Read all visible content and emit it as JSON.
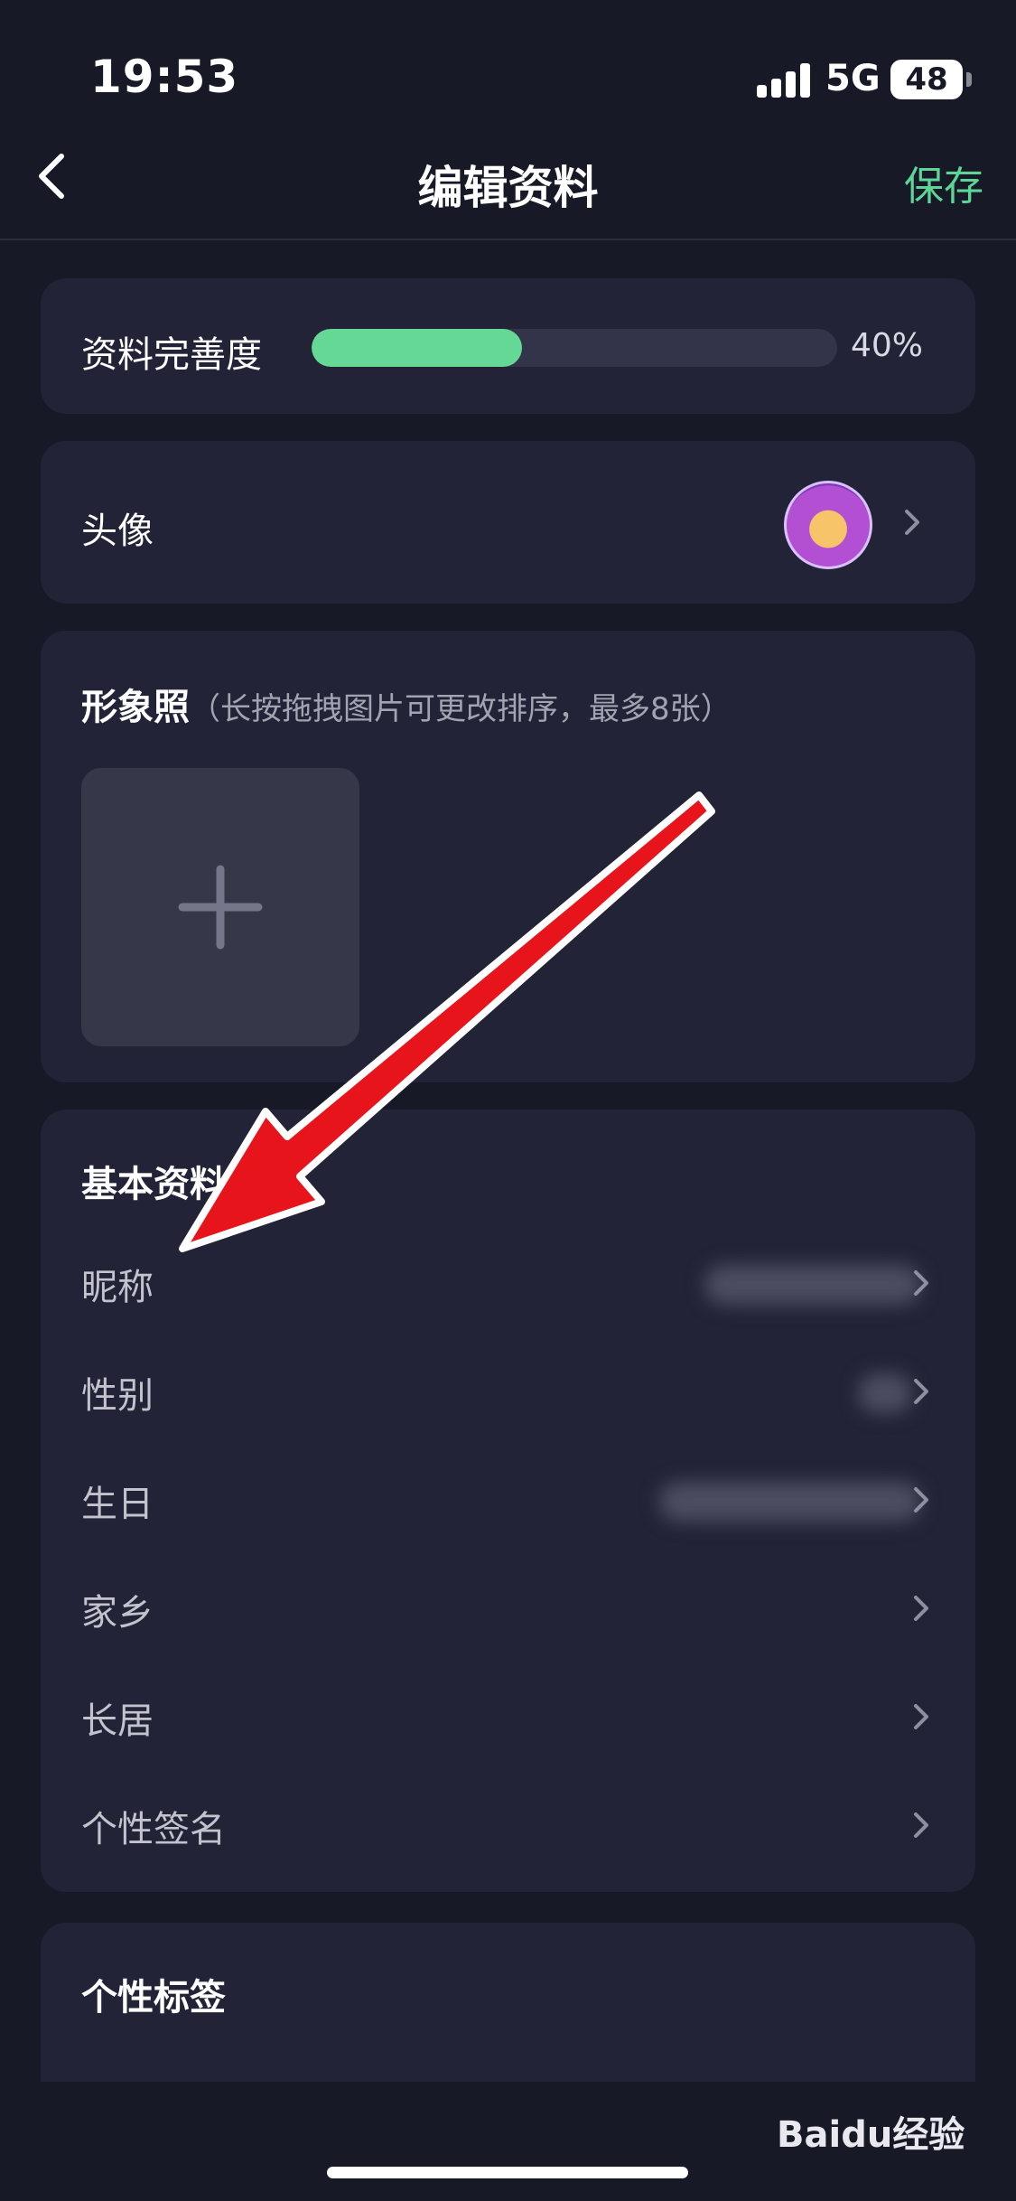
{
  "status_bar": {
    "time": "19:53",
    "network": "5G",
    "battery": "48"
  },
  "nav": {
    "title": "编辑资料",
    "save_label": "保存"
  },
  "completeness": {
    "label": "资料完善度",
    "percent_text": "40%",
    "progress": 0.4
  },
  "avatar": {
    "label": "头像"
  },
  "photos": {
    "title": "形象照",
    "hint": "（长按拖拽图片可更改排序，最多8张）"
  },
  "basic_info": {
    "title": "基本资料",
    "rows": [
      {
        "label": "昵称"
      },
      {
        "label": "性别"
      },
      {
        "label": "生日"
      },
      {
        "label": "家乡"
      },
      {
        "label": "长居"
      },
      {
        "label": "个性签名"
      }
    ]
  },
  "tags": {
    "title": "个性标签"
  },
  "watermark": "Baidu经验",
  "colors": {
    "accent": "#5cd596",
    "progress": "#64d894",
    "background": "#181927",
    "card": "#222337",
    "annotation_arrow": "#e8141c"
  }
}
